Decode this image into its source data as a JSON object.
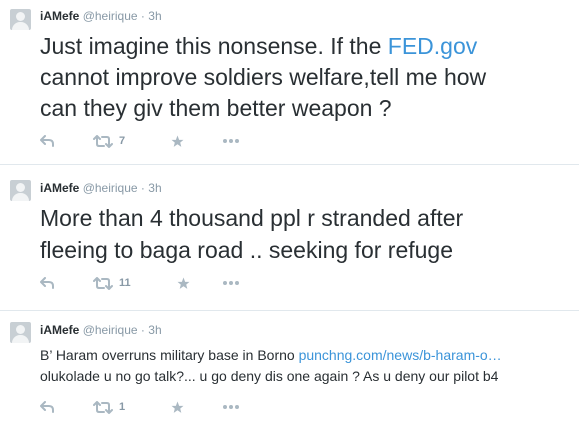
{
  "tweets": [
    {
      "name": "iAMefe",
      "handle": "@heirique",
      "dot": "·",
      "time": "3h",
      "line1_before": "Just imagine this nonsense. If the ",
      "line1_link": "FED.gov",
      "line2": "cannot improve soldiers welfare,tell me how",
      "line3": "can they giv them better weapon ?",
      "retweets": "7"
    },
    {
      "name": "iAMefe",
      "handle": "@heirique",
      "dot": "·",
      "time": "3h",
      "line1": "More than 4 thousand ppl r stranded after",
      "line2": "fleeing to baga road .. seeking for refuge",
      "retweets": "11"
    },
    {
      "name": "iAMefe",
      "handle": "@heirique",
      "dot": "·",
      "time": "3h",
      "line1_before": "B’ Haram overruns military base in Borno ",
      "line1_link": "punchng.com/news/b-haram-o…",
      "line2": "olukolade u no go talk?... u go deny dis one again ? As u deny our pilot b4",
      "retweets": "1"
    }
  ],
  "icons": {
    "reply": "reply-icon",
    "retweet": "retweet-icon",
    "favorite": "star-icon",
    "more": "more-icon"
  },
  "colors": {
    "link": "#3b94d9",
    "meta": "#8899a6",
    "action_icon": "#aab8c2",
    "divider": "#e1e8ed"
  }
}
